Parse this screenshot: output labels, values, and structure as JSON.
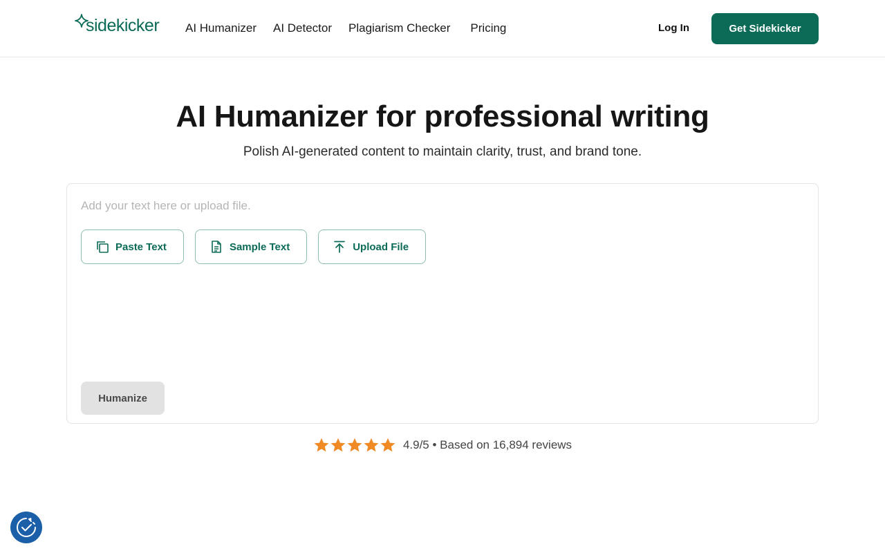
{
  "brand": {
    "name": "sidekicker",
    "color": "#0b6b57"
  },
  "nav": {
    "items": [
      {
        "label": "AI Humanizer"
      },
      {
        "label": "AI Detector"
      },
      {
        "label": "Plagiarism Checker"
      },
      {
        "label": "Pricing"
      }
    ],
    "login_label": "Log In",
    "cta_label": "Get Sidekicker"
  },
  "hero": {
    "title": "AI Humanizer for professional writing",
    "subtitle": "Polish AI-generated content to maintain clarity, trust, and brand tone."
  },
  "editor": {
    "placeholder": "Add your text here or upload file.",
    "value": "",
    "actions": [
      {
        "label": "Paste Text",
        "icon": "copy-icon"
      },
      {
        "label": "Sample Text",
        "icon": "document-icon"
      },
      {
        "label": "Upload File",
        "icon": "upload-icon"
      }
    ],
    "submit_label": "Humanize",
    "submit_enabled": false
  },
  "rating": {
    "stars": 5,
    "star_color": "#f08a24",
    "text": "4.9/5 • Based on 16,894 reviews"
  },
  "consent": {
    "icon": "cookie-consent-icon",
    "color": "#1a5fa8"
  }
}
